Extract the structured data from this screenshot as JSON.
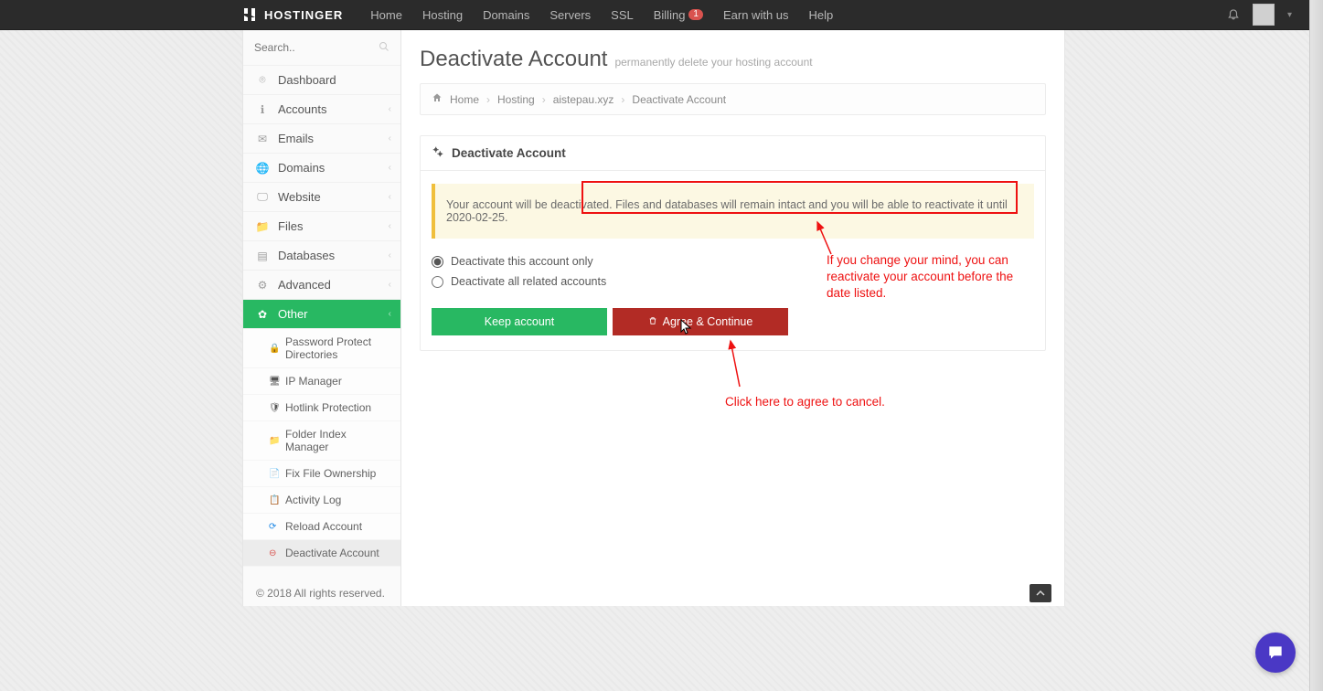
{
  "brand": "HOSTINGER",
  "nav": {
    "home": "Home",
    "hosting": "Hosting",
    "domains": "Domains",
    "servers": "Servers",
    "ssl": "SSL",
    "billing": "Billing",
    "billing_badge": "1",
    "earn": "Earn with us",
    "help": "Help"
  },
  "search": {
    "placeholder": "Search.."
  },
  "sidebar": {
    "dashboard": "Dashboard",
    "accounts": "Accounts",
    "emails": "Emails",
    "domains": "Domains",
    "website": "Website",
    "files": "Files",
    "databases": "Databases",
    "advanced": "Advanced",
    "other": "Other"
  },
  "other_items": {
    "password_protect": "Password Protect Directories",
    "ip_manager": "IP Manager",
    "hotlink": "Hotlink Protection",
    "folder_index": "Folder Index Manager",
    "fix_file": "Fix File Ownership",
    "activity_log": "Activity Log",
    "reload": "Reload Account",
    "deactivate": "Deactivate Account"
  },
  "page": {
    "title": "Deactivate Account",
    "subtitle": "permanently delete your hosting account",
    "crumb_home": "Home",
    "crumb_hosting": "Hosting",
    "crumb_domain": "aistepau.xyz",
    "crumb_current": "Deactivate Account",
    "panel_title": "Deactivate Account",
    "notice": "Your account will be deactivated. Files and databases will remain intact and you will be able to reactivate it until 2020-02-25.",
    "radio1": "Deactivate this account only",
    "radio2": "Deactivate all related accounts",
    "keep_btn": "Keep account",
    "agree_btn": "Agree & Continue"
  },
  "annotations": {
    "reactivate": "If you change your mind, you can reactivate your account before the date listed.",
    "agree": "Click here to agree to cancel."
  },
  "footer": "© 2018 All rights reserved."
}
